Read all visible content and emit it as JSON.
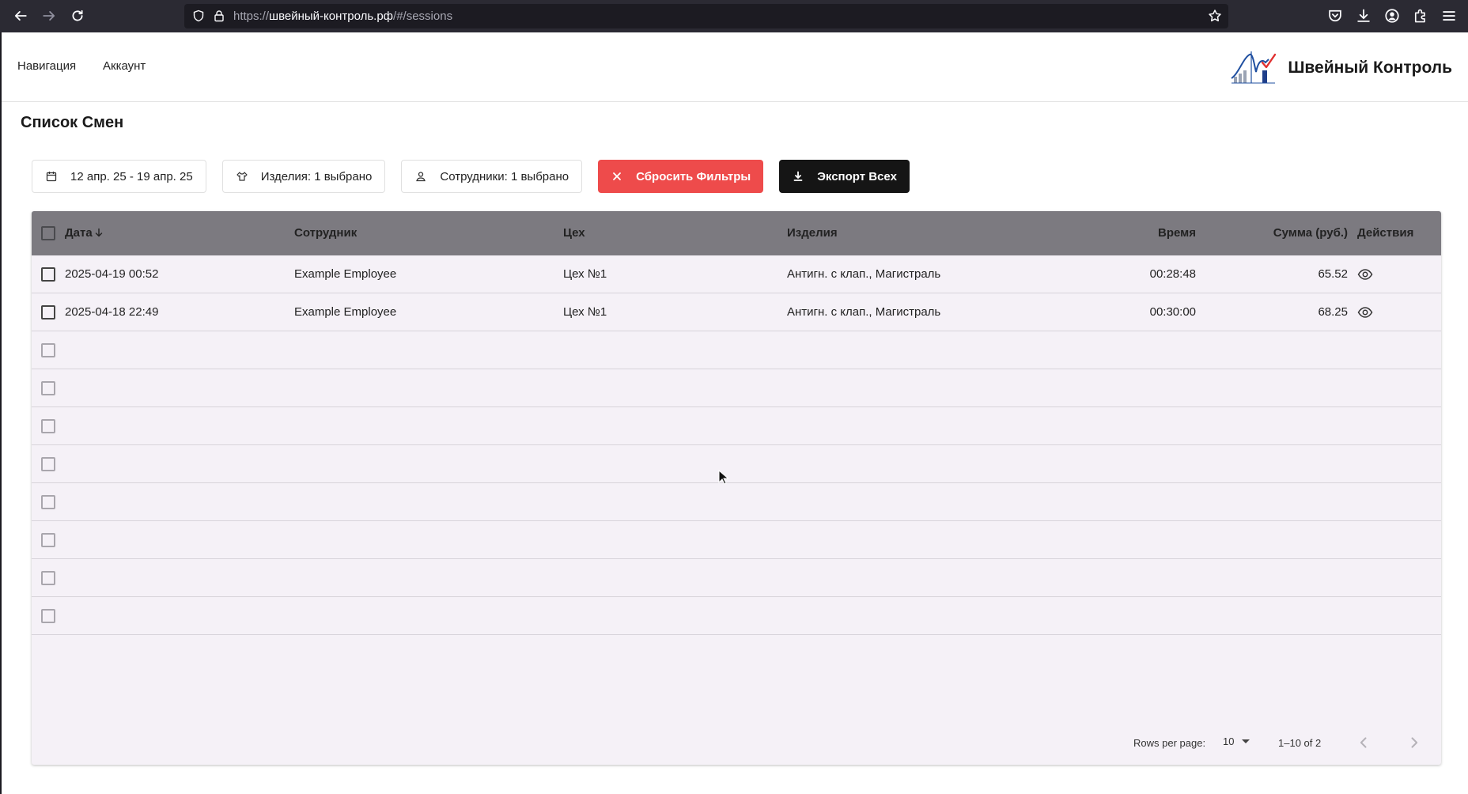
{
  "browser": {
    "url_prefix": "https://",
    "url_host": "швейный-контроль.рф",
    "url_path": "/#/sessions"
  },
  "header": {
    "nav_label": "Навигация",
    "account_label": "Аккаунт",
    "brand_name": "Швейный Контроль"
  },
  "page": {
    "title": "Список Смен"
  },
  "filters": {
    "date_range": "12 апр. 25 - 19 апр. 25",
    "products": "Изделия: 1 выбрано",
    "employees": "Сотрудники: 1 выбрано",
    "reset": "Сбросить Фильтры",
    "export": "Экспорт Всех"
  },
  "table": {
    "columns": {
      "date": "Дата",
      "employee": "Сотрудник",
      "workshop": "Цех",
      "products": "Изделия",
      "time": "Время",
      "sum": "Сумма (руб.)",
      "actions": "Действия"
    },
    "rows": [
      {
        "date": "2025-04-19 00:52",
        "employee": "Example Employee",
        "workshop": "Цех №1",
        "products": "Антигн. с клап., Магистраль",
        "time": "00:28:48",
        "sum": "65.52"
      },
      {
        "date": "2025-04-18 22:49",
        "employee": "Example Employee",
        "workshop": "Цех №1",
        "products": "Антигн. с клап., Магистраль",
        "time": "00:30:00",
        "sum": "68.25"
      }
    ]
  },
  "pagination": {
    "rows_per_page_label": "Rows per page:",
    "rows_per_page": "10",
    "range": "1–10 of 2"
  },
  "colors": {
    "reset_button": "#ee4b4b",
    "export_button": "#151515",
    "table_header": "#7c7a80",
    "table_body": "#f5f1f7"
  }
}
